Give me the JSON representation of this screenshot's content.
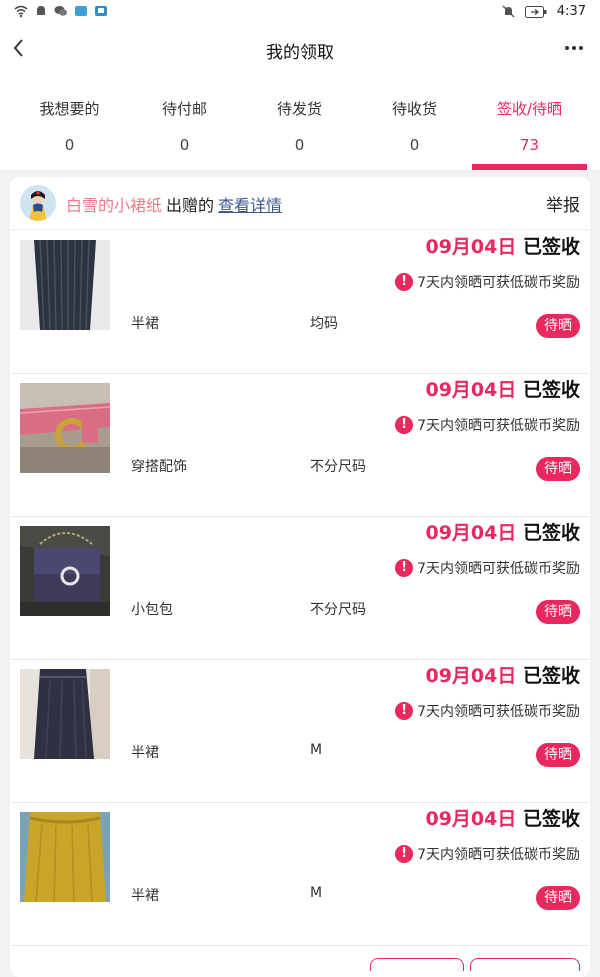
{
  "status_bar": {
    "time": "4:37"
  },
  "header": {
    "title": "我的领取"
  },
  "tabs": [
    {
      "label": "我想要的",
      "count": "0"
    },
    {
      "label": "待付邮",
      "count": "0"
    },
    {
      "label": "待发货",
      "count": "0"
    },
    {
      "label": "待收货",
      "count": "0"
    },
    {
      "label": "签收/待晒",
      "count": "73"
    }
  ],
  "giver": {
    "name": "白雪的小裙纸",
    "action": "出赠的",
    "details_link": "查看详情",
    "report": "举报"
  },
  "items": [
    {
      "date": "09月04日",
      "status": "已签收",
      "notice": "7天内领晒可获低碳币奖励",
      "category": "半裙",
      "size": "均码",
      "badge": "待晒"
    },
    {
      "date": "09月04日",
      "status": "已签收",
      "notice": "7天内领晒可获低碳币奖励",
      "category": "穿搭配饰",
      "size": "不分尺码",
      "badge": "待晒"
    },
    {
      "date": "09月04日",
      "status": "已签收",
      "notice": "7天内领晒可获低碳币奖励",
      "category": "小包包",
      "size": "不分尺码",
      "badge": "待晒"
    },
    {
      "date": "09月04日",
      "status": "已签收",
      "notice": "7天内领晒可获低碳币奖励",
      "category": "半裙",
      "size": "M",
      "badge": "待晒"
    },
    {
      "date": "09月04日",
      "status": "已签收",
      "notice": "7天内领晒可获低碳币奖励",
      "category": "半裙",
      "size": "M",
      "badge": "待晒"
    }
  ],
  "colors": {
    "accent": "#e8285f",
    "giver_name": "#f07a8a",
    "link": "#3a5a90"
  },
  "icons": [
    "back-arrow-icon",
    "more-icon",
    "alert-icon",
    "wifi-icon",
    "battery-icon",
    "mute-icon"
  ]
}
